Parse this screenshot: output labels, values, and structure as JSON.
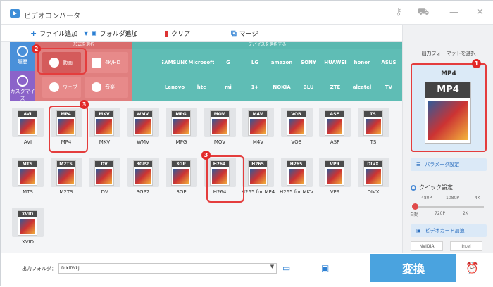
{
  "app": {
    "title": "ビデオコンバータ",
    "icon": "app-logo-icon"
  },
  "window_controls": [
    "key-icon",
    "cart-icon",
    "minimize-icon",
    "close-icon"
  ],
  "toolbar": {
    "add_file": "ファイル追加",
    "add_folder": "フォルダ追加",
    "clear": "クリア",
    "merge": "マージ"
  },
  "categories": {
    "format_header": "形式を選択",
    "device_header": "デバイスを選択する",
    "side_tabs": [
      {
        "label": "履歴",
        "icon": "history-icon"
      },
      {
        "label": "カスタマイズ",
        "icon": "customize-icon"
      }
    ],
    "format_tabs": [
      {
        "label": "動画",
        "icon": "video-play-icon"
      },
      {
        "label": "4K/HD",
        "icon": "4k-icon"
      },
      {
        "label": "ウェブ",
        "icon": "web-icon"
      },
      {
        "label": "音楽",
        "icon": "music-icon"
      }
    ],
    "devices": [
      "",
      "SAMSUNG",
      "Microsoft",
      "G",
      "LG",
      "amazon",
      "SONY",
      "HUAWEI",
      "honor",
      "ASUS",
      "",
      "Lenovo",
      "htc",
      "mi",
      "1+",
      "NOKIA",
      "BLU",
      "ZTE",
      "alcatel",
      "TV"
    ]
  },
  "formats": [
    {
      "name": "AVI"
    },
    {
      "name": "MP4"
    },
    {
      "name": "MKV"
    },
    {
      "name": "WMV"
    },
    {
      "name": "MPG"
    },
    {
      "name": "MOV"
    },
    {
      "name": "M4V"
    },
    {
      "name": "VOB"
    },
    {
      "name": "ASF"
    },
    {
      "name": "TS"
    },
    {
      "name": "MTS"
    },
    {
      "name": "M2TS"
    },
    {
      "name": "DV"
    },
    {
      "name": "3GP2"
    },
    {
      "name": "3GP"
    },
    {
      "name": "H264"
    },
    {
      "name": "H265 for MP4"
    },
    {
      "name": "H265 for MKV"
    },
    {
      "name": "VP9"
    },
    {
      "name": "DIVX"
    },
    {
      "name": "XVID"
    }
  ],
  "output": {
    "header": "出力フォーマットを選択",
    "selected": "MP4",
    "param_button": "パラメータ設定",
    "quick_label": "クイック設定",
    "slider_top": [
      "480P",
      "1080P",
      "4K"
    ],
    "slider_bottom": [
      "自動",
      "720P",
      "2K"
    ],
    "gpu_button": "ビデオカード加速",
    "gpu_vendors": [
      "NVIDIA",
      "Intel"
    ]
  },
  "bottom": {
    "folder_label": "出力フォルダ：",
    "folder_path": "D:¥ffWkj",
    "convert": "変換"
  },
  "annotations": [
    "1",
    "2",
    "3",
    "3"
  ]
}
